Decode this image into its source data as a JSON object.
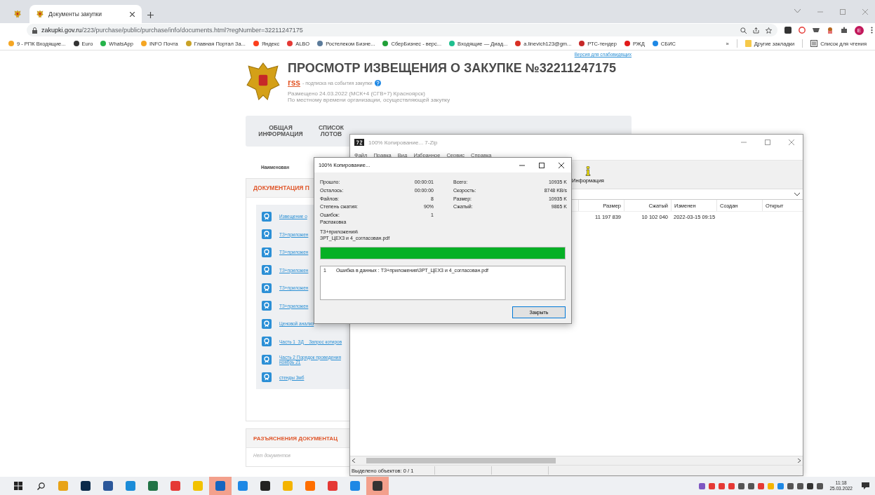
{
  "browser": {
    "tabs": [
      {
        "title": "Документы закупки",
        "selected": true
      }
    ],
    "url_host": "zakupki.gov.ru",
    "url_path": "/223/purchase/public/purchase/info/documents.html?regNumber=32211247175",
    "profile_initial": "E",
    "bookmarks": [
      {
        "label": "9 - РПК Входящие...",
        "color": "#f5a623"
      },
      {
        "label": "Euro",
        "color": "#333333"
      },
      {
        "label": "WhatsApp",
        "color": "#25b34a"
      },
      {
        "label": "INFO Почта",
        "color": "#f5a623"
      },
      {
        "label": "Главная Портал За...",
        "color": "#c9a227"
      },
      {
        "label": "Яндекс",
        "color": "#fc3f1d"
      },
      {
        "label": "ALBO",
        "color": "#e53935"
      },
      {
        "label": "Ростелеком Бизне...",
        "color": "#5b7b9a"
      },
      {
        "label": "СберБизнес - верс...",
        "color": "#21a038"
      },
      {
        "label": "Входящие — Диад...",
        "color": "#1fbf8f"
      },
      {
        "label": "a.linevich123@gm...",
        "color": "#d93025"
      },
      {
        "label": "РТС-тендер",
        "color": "#c62828"
      },
      {
        "label": "РЖД",
        "color": "#e21a1a"
      },
      {
        "label": "СБИС",
        "color": "#1e88e5"
      }
    ],
    "bookmarks_more": "»",
    "other_bookmarks": "Другие закладки",
    "reading_list": "Список для чтения"
  },
  "page": {
    "accessibility_link": "Версия для слабовидящих",
    "title": "ПРОСМОТР ИЗВЕЩЕНИЯ О ЗАКУПКЕ №32211247175",
    "rss": "rss",
    "rss_caption": "- подписка на события закупки",
    "posted": "Размещено 24.03.2022 (МСК+4 (СГВ+7) Красноярск)",
    "time_note": "По местному времени организации, осуществляющей закупку",
    "nav_tabs": [
      {
        "label": "ОБЩАЯ ИНФОРМАЦИЯ"
      },
      {
        "label": "СПИСОК ЛОТОВ"
      }
    ],
    "column_header": "Наименован",
    "documents_section": {
      "title": "ДОКУМЕНТАЦИЯ П",
      "documents": [
        "Извещение о",
        "ТЗ+приложен",
        "ТЗ+приложен",
        "ТЗ+приложен",
        "ТЗ+приложен",
        "ТЗ+приложен",
        "Ценовой анализ",
        "Часть 1_ЗД__Запрос котиров",
        "Часть 2 Порядок проведения ноябрь 21",
        "стенды 3мб"
      ]
    },
    "clarifications_section": {
      "title": "РАЗЪЯСНЕНИЯ ДОКУМЕНТАЦ",
      "empty_text": "Нет документов"
    }
  },
  "archiver_window": {
    "title": "100% Копирование... 7-Zip",
    "menu": [
      "Файл",
      "Правка",
      "Вид",
      "Избранное",
      "Сервис",
      "Справка"
    ],
    "toolbar_button": "Информация",
    "columns": [
      "Размер",
      "Сжатый",
      "Изменен",
      "Создан",
      "Открыт"
    ],
    "rows": [
      [
        "11 197 839",
        "10 102 040",
        "2022-03-15 09:15",
        "",
        ""
      ]
    ],
    "status": "Выделено объектов: 0 / 1"
  },
  "copy_dialog": {
    "title": "100% Копирование...",
    "stats_left": [
      {
        "label": "Прошло:",
        "value": "00:00:01"
      },
      {
        "label": "Осталось:",
        "value": "00:00:00"
      },
      {
        "label": "Файлов:",
        "value": "8"
      },
      {
        "label": "Степень сжатия:",
        "value": "90%"
      },
      {
        "label": "Ошибок:",
        "value": "1"
      }
    ],
    "stats_right": [
      {
        "label": "Всего:",
        "value": "10935 K"
      },
      {
        "label": "Скорость:",
        "value": "8748 KB/s"
      },
      {
        "label": "Размер:",
        "value": "10935 K"
      },
      {
        "label": "Сжатый:",
        "value": "9865 K"
      }
    ],
    "operation": "Распаковка",
    "path_lines": [
      "ТЗ+приложения\\",
      "ЗРТ_ЦЕХ3 и 4_согласован.pdf"
    ],
    "progress": {
      "level": 1
    },
    "errors": [
      {
        "number": "1",
        "text": "Ошибка в данных : ТЗ+приложения\\ЗРТ_ЦЕХ3 и 4_согласован.pdf"
      }
    ],
    "close_button": "Закрыть"
  },
  "taskbar": {
    "apps": [
      {
        "color": "#e8a317",
        "active": false
      },
      {
        "color": "#0b2a4a",
        "active": false
      },
      {
        "color": "#2b579a",
        "active": false
      },
      {
        "color": "#1b8cd8",
        "active": false
      },
      {
        "color": "#217346",
        "active": false
      },
      {
        "color": "#e53935",
        "active": false
      },
      {
        "color": "#f2c200",
        "active": false
      },
      {
        "color": "#1565c0",
        "active": true
      },
      {
        "color": "#1e88e5",
        "active": false
      },
      {
        "color": "#222222",
        "active": false
      },
      {
        "color": "#f4b400",
        "active": false
      },
      {
        "color": "#ff6f00",
        "active": false
      },
      {
        "color": "#e53935",
        "active": false
      },
      {
        "color": "#1e88e5",
        "active": false
      },
      {
        "color": "#333333",
        "active": true
      }
    ],
    "time": "11:18",
    "date": "25.03.2022"
  }
}
